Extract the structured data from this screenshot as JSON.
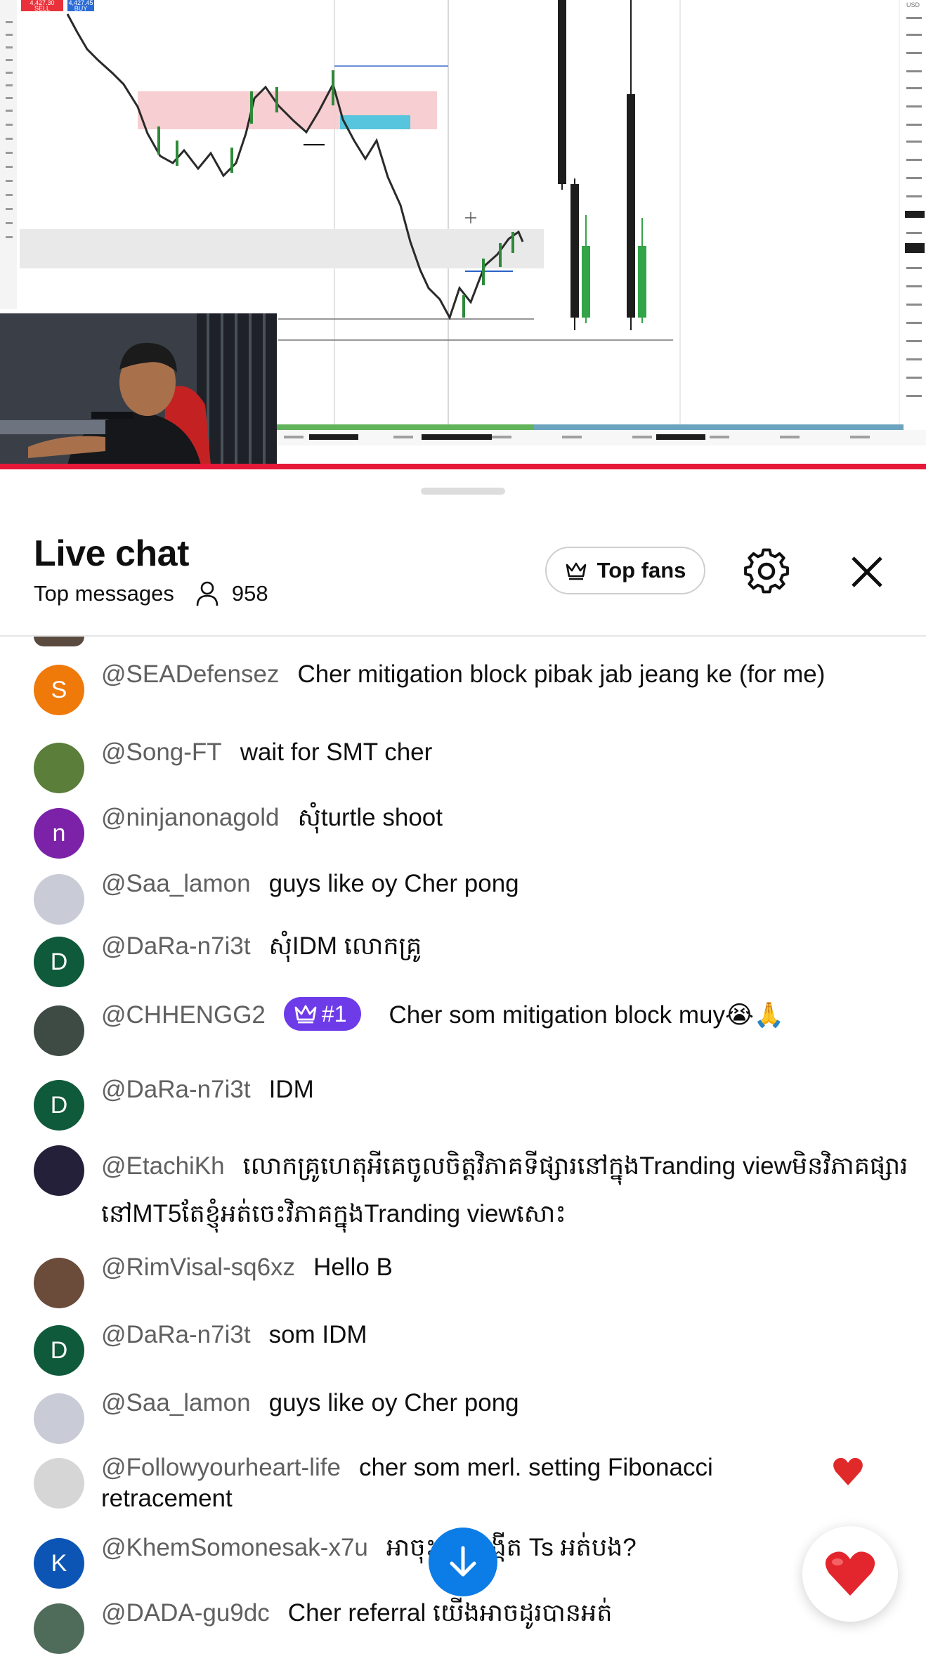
{
  "chat": {
    "title": "Live chat",
    "mode": "Top messages",
    "viewer_count": "958",
    "top_fans_label": "Top fans"
  },
  "chart_overlay": {
    "ticket_sell": "4,427.30",
    "ticket_buy": "4,427.45",
    "label_sell": "SELL",
    "label_buy": "BUY",
    "currency": "USD"
  },
  "messages": [
    {
      "author": "@SEADefensez",
      "text": "Cher mitigation block pibak jab jeang ke (for me)",
      "avatar_letter": "S",
      "avatar_color": "#ef7a0a"
    },
    {
      "author": "@Song-FT",
      "text": "wait for SMT cher",
      "avatar_letter": "",
      "avatar_color": "#5b7f3a"
    },
    {
      "author": "@ninjanonagold",
      "text": "សុំturtle shoot",
      "avatar_letter": "n",
      "avatar_color": "#7b22a8"
    },
    {
      "author": "@Saa_lamon",
      "text": "guys like oy Cher pong",
      "avatar_letter": "",
      "avatar_color": "#c9ccd6"
    },
    {
      "author": "@DaRa-n7i3t",
      "text": "សុំIDM លោកគ្រូ",
      "avatar_letter": "D",
      "avatar_color": "#0f5a3b"
    },
    {
      "author": "@CHHENGG2",
      "badge": "#1",
      "text": "Cher som mitigation block muy😭🙏",
      "avatar_letter": "",
      "avatar_color": "#3d4b44"
    },
    {
      "author": "@DaRa-n7i3t",
      "text": "IDM",
      "avatar_letter": "D",
      "avatar_color": "#0f5a3b"
    },
    {
      "author": "@EtachiKh",
      "text": "លោកគ្រូហេតុអីគេចូលចិត្តវិភាគទីផ្សារនៅក្នុងTranding viewមិនវិភាគផ្សារនៅMT5តែខ្ញុំអត់ចេះវិភាគក្នុងTranding viewសោះ",
      "avatar_letter": "",
      "avatar_color": "#24203a"
    },
    {
      "author": "@RimVisal-sq6xz",
      "text": "Hello B",
      "avatar_letter": "",
      "avatar_color": "#6b4b3a"
    },
    {
      "author": "@DaRa-n7i3t",
      "text": "som IDM",
      "avatar_letter": "D",
      "avatar_color": "#0f5a3b"
    },
    {
      "author": "@Saa_lamon",
      "text": "guys like oy Cher pong",
      "avatar_letter": "",
      "avatar_color": "#c9ccd6"
    },
    {
      "author": "@Followyourheart-life",
      "text": "cher som merl. setting Fibonacci retracement",
      "avatar_letter": "",
      "avatar_color": "#d6d6d6"
    },
    {
      "author": "@KhemSomonesak-x7u",
      "text": "អាចុះមកបង្កើត Ts អត់បង?",
      "avatar_letter": "K",
      "avatar_color": "#0c55b5"
    },
    {
      "author": "@DADA-gu9dc",
      "text": "Cher referral យើងអាចដូរបានអត់",
      "avatar_letter": "",
      "avatar_color": "#4f6b5a"
    }
  ]
}
